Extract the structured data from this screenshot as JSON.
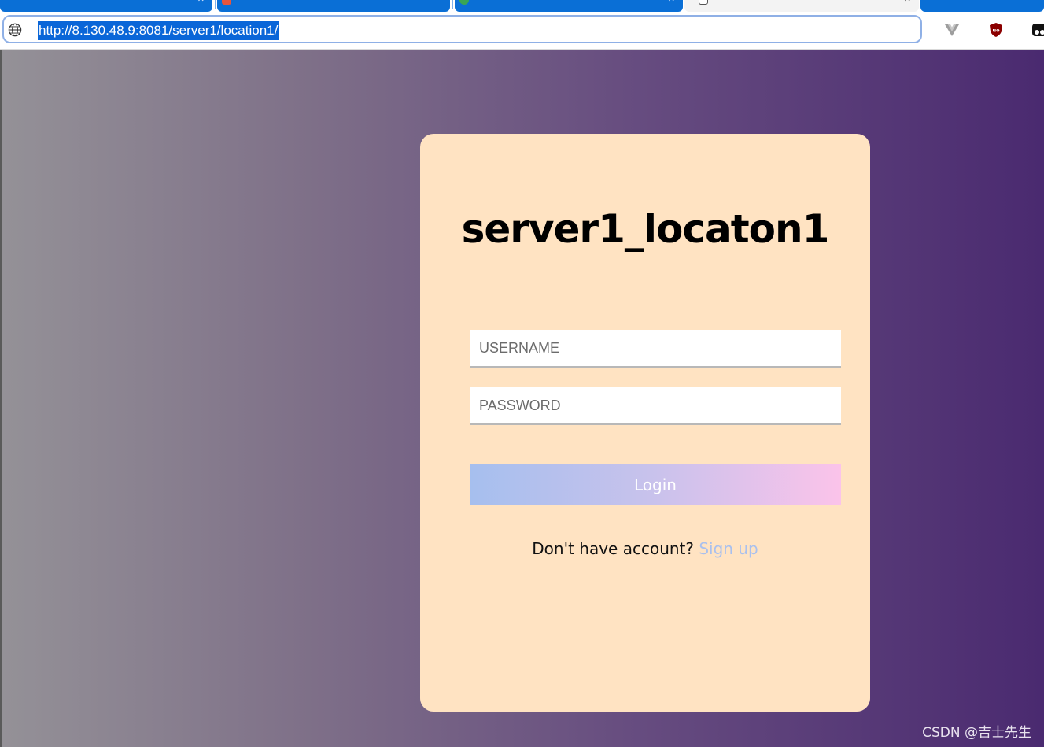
{
  "browser": {
    "url": "http://8.130.48.9:8081/server1/location1/"
  },
  "page": {
    "title": "server1_locaton1",
    "username_placeholder": "USERNAME",
    "password_placeholder": "PASSWORD",
    "login_label": "Login",
    "signup_prompt": "Don't have account?",
    "signup_link": "Sign up"
  },
  "watermark": "CSDN @吉士先生",
  "colors": {
    "card_bg": "#ffe3c2",
    "page_gradient_start": "#949197",
    "page_gradient_end": "#4a2a70",
    "login_gradient_start": "#a6bfee",
    "login_gradient_end": "#fbc3ea",
    "signup_link": "#a9c0ee",
    "url_highlight": "#0a66d8"
  },
  "icons": {
    "address": "globe-icon",
    "extensions": [
      "vue-devtools-icon",
      "ublock-icon",
      "extension-icon"
    ]
  }
}
